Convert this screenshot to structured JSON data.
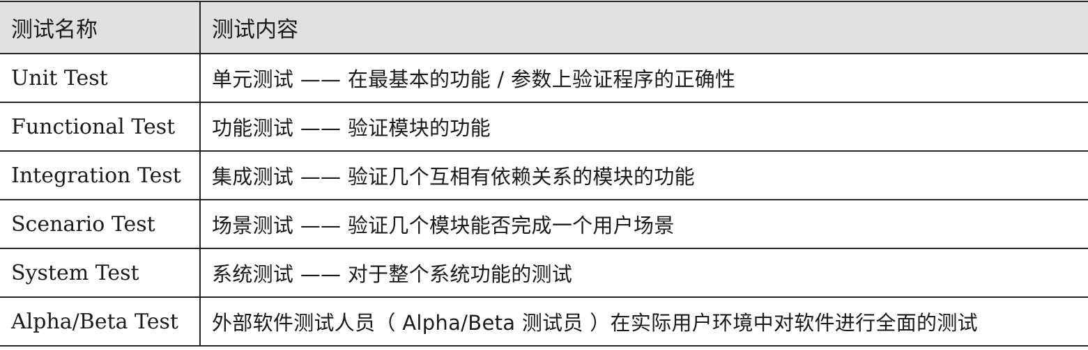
{
  "table": {
    "headers": [
      "测试名称",
      "测试内容"
    ],
    "rows": [
      {
        "name": "Unit Test",
        "content": "单元测试 —— 在最基本的功能 / 参数上验证程序的正确性"
      },
      {
        "name": "Functional Test",
        "content": "功能测试 —— 验证模块的功能"
      },
      {
        "name": "Integration Test",
        "content": "集成测试 —— 验证几个互相有依赖关系的模块的功能"
      },
      {
        "name": "Scenario Test",
        "content": "场景测试 —— 验证几个模块能否完成一个用户场景"
      },
      {
        "name": "System Test",
        "content": "系统测试 —— 对于整个系统功能的测试"
      },
      {
        "name": "Alpha/Beta Test",
        "content": "外部软件测试人员（ Alpha/Beta 测试员 ）在实际用户环境中对软件进行全面的测试"
      }
    ]
  }
}
